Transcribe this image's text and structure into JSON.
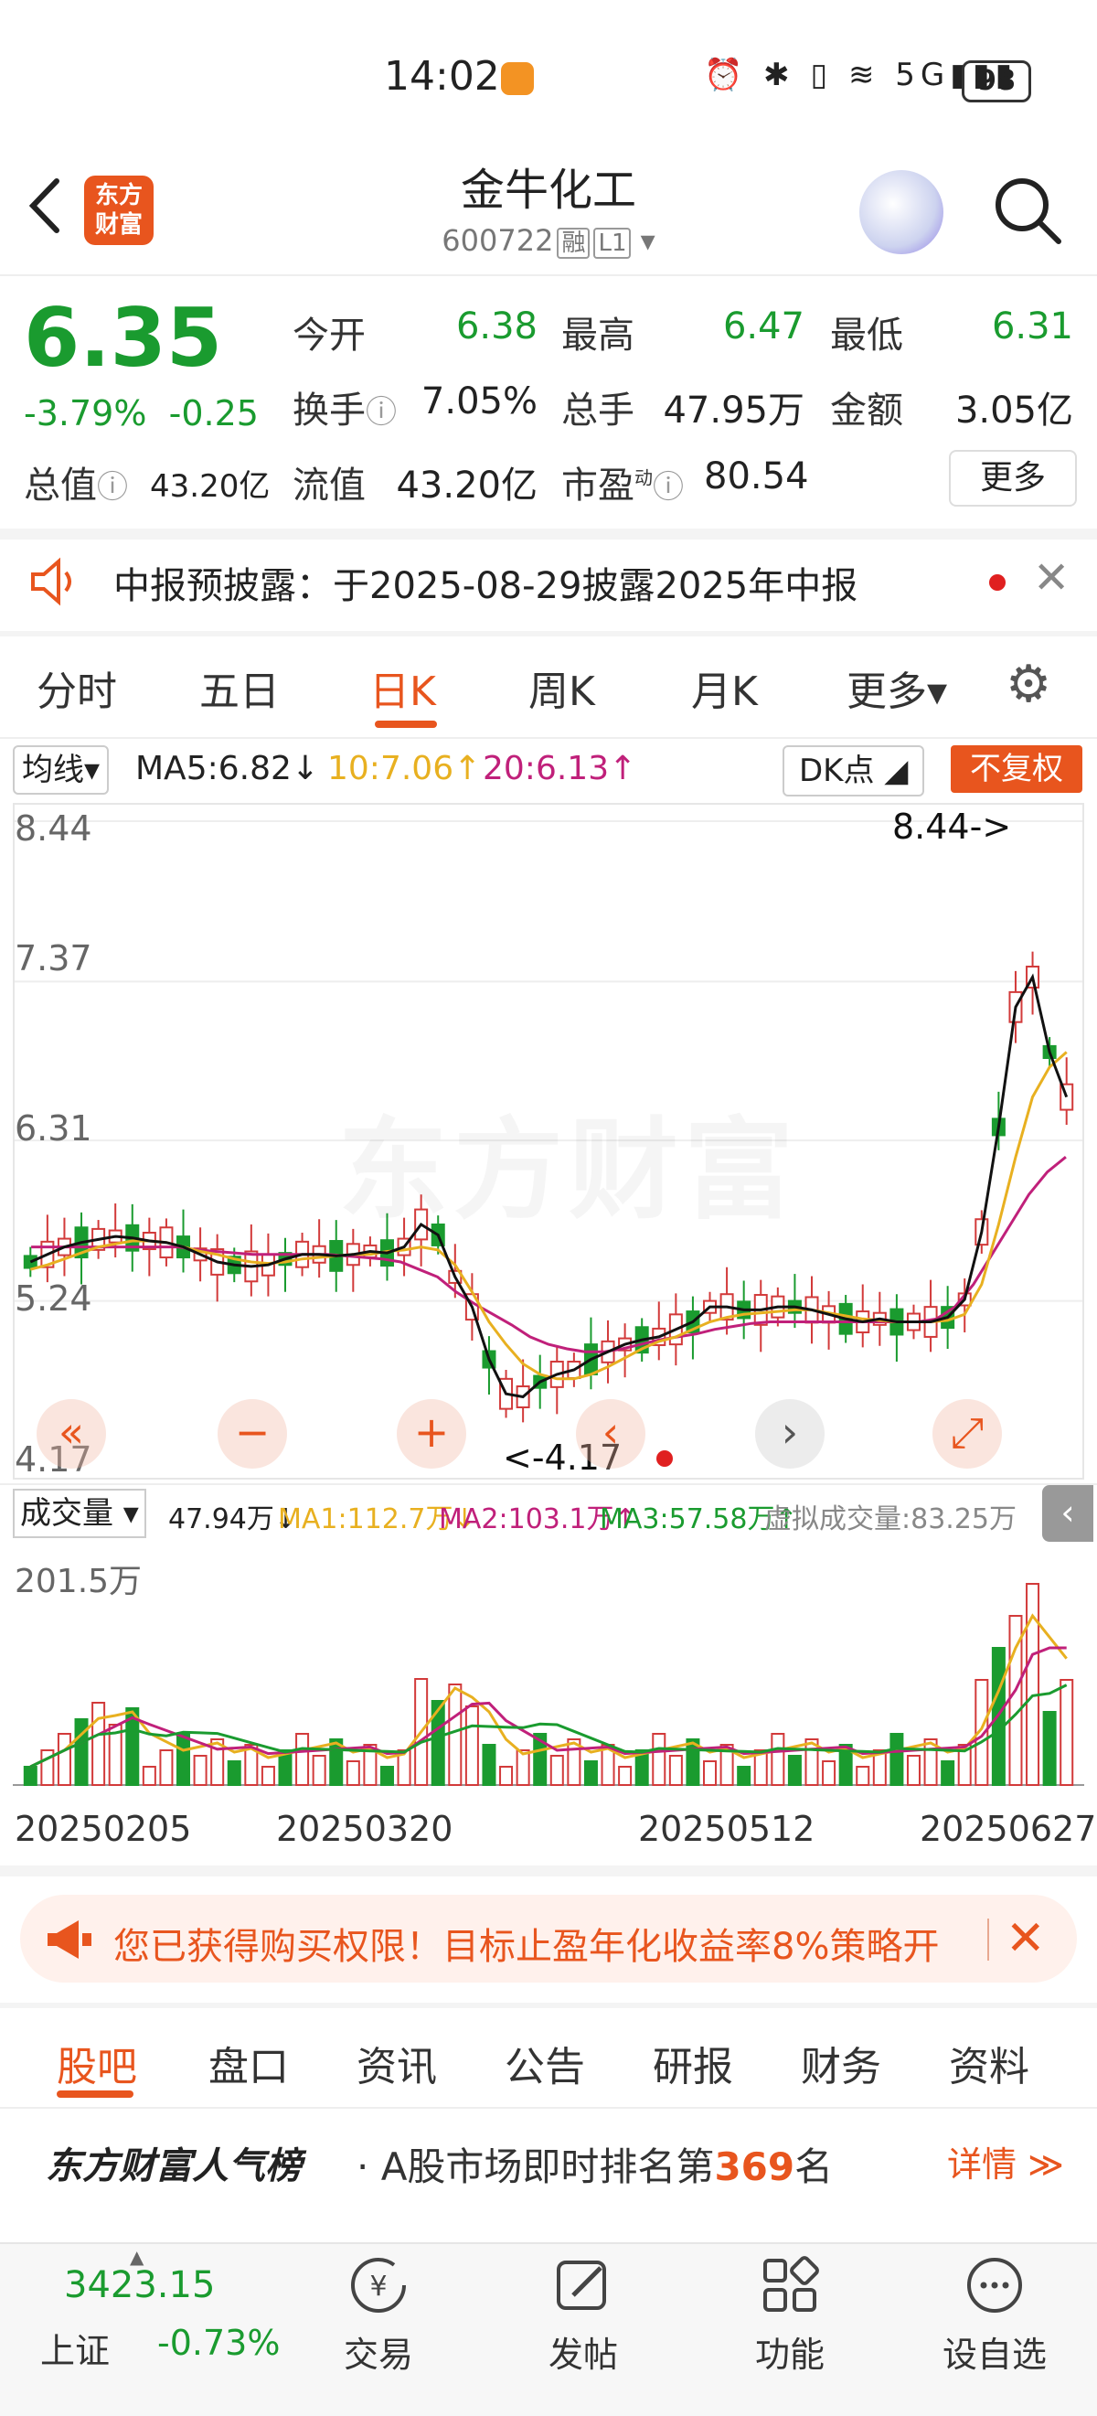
{
  "status_bar": {
    "time": "14:02",
    "battery": "98",
    "signal": "5G"
  },
  "header": {
    "logo_line1": "东方",
    "logo_line2": "财富",
    "title": "金牛化工",
    "code": "600722",
    "tag1": "融",
    "tag2": "L1"
  },
  "quote": {
    "price": "6.35",
    "change_pct": "-3.79%",
    "change": "-0.25",
    "open_label": "今开",
    "open": "6.38",
    "high_label": "最高",
    "high": "6.47",
    "low_label": "最低",
    "low": "6.31",
    "turnover_label": "换手",
    "turnover": "7.05%",
    "volume_label": "总手",
    "volume": "47.95万",
    "amount_label": "金额",
    "amount": "3.05亿",
    "mktcap_label": "总值",
    "mktcap": "43.20亿",
    "float_label": "流值",
    "float_cap": "43.20亿",
    "pe_label": "市盈",
    "pe_sup": "动",
    "pe": "80.54",
    "more_label": "更多"
  },
  "notice": {
    "text": "中报预披露：于2025-08-29披露2025年中报"
  },
  "chart_tabs": [
    {
      "label": "分时"
    },
    {
      "label": "五日"
    },
    {
      "label": "日K"
    },
    {
      "label": "周K"
    },
    {
      "label": "月K"
    },
    {
      "label": "更多▾"
    }
  ],
  "ma_bar": {
    "select": "均线",
    "ma5": "MA5:6.82↓",
    "ma10": "10:7.06↑",
    "ma20": "20:6.13↑",
    "dk": "DK点",
    "fuquan": "不复权"
  },
  "chart_data": {
    "type": "candlestick",
    "y_labels": [
      "8.44",
      "7.37",
      "6.31",
      "5.24",
      "4.17"
    ],
    "ylim": [
      4.17,
      8.44
    ],
    "max_annotation": "8.44->",
    "min_annotation": "<-4.17",
    "watermark": "东方财富",
    "colors": {
      "up": "#d23a3a",
      "down": "#1a9b2f",
      "ma5": "#111111",
      "ma10": "#e8b020",
      "ma20": "#c0207a"
    },
    "ma5": [
      5.5,
      5.55,
      5.6,
      5.63,
      5.65,
      5.67,
      5.66,
      5.64,
      5.63,
      5.6,
      5.55,
      5.5,
      5.48,
      5.47,
      5.48,
      5.52,
      5.55,
      5.55,
      5.54,
      5.55,
      5.57,
      5.56,
      5.6,
      5.75,
      5.68,
      5.4,
      5.2,
      4.85,
      4.62,
      4.6,
      4.7,
      4.75,
      4.78,
      4.85,
      4.9,
      4.95,
      4.98,
      5.0,
      5.05,
      5.1,
      5.2,
      5.2,
      5.18,
      5.18,
      5.2,
      5.2,
      5.18,
      5.15,
      5.12,
      5.1,
      5.12,
      5.1,
      5.1,
      5.1,
      5.13,
      5.25,
      5.7,
      6.4,
      7.2,
      7.4,
      6.9,
      6.6
    ],
    "ma10": [
      5.45,
      5.48,
      5.52,
      5.56,
      5.6,
      5.62,
      5.64,
      5.64,
      5.63,
      5.6,
      5.57,
      5.55,
      5.52,
      5.5,
      5.49,
      5.5,
      5.52,
      5.53,
      5.54,
      5.55,
      5.55,
      5.57,
      5.58,
      5.6,
      5.58,
      5.48,
      5.3,
      5.1,
      4.95,
      4.82,
      4.75,
      4.72,
      4.72,
      4.75,
      4.8,
      4.86,
      4.92,
      4.97,
      5.0,
      5.05,
      5.1,
      5.13,
      5.15,
      5.16,
      5.17,
      5.18,
      5.18,
      5.16,
      5.14,
      5.12,
      5.11,
      5.1,
      5.1,
      5.1,
      5.11,
      5.15,
      5.35,
      5.75,
      6.2,
      6.6,
      6.8,
      6.9
    ],
    "ma20": [
      5.6,
      5.6,
      5.6,
      5.6,
      5.6,
      5.6,
      5.6,
      5.6,
      5.6,
      5.58,
      5.57,
      5.56,
      5.55,
      5.55,
      5.55,
      5.55,
      5.55,
      5.54,
      5.53,
      5.52,
      5.5,
      5.45,
      5.4,
      5.3,
      5.22,
      5.15,
      5.08,
      5.0,
      4.95,
      4.92,
      4.9,
      4.9,
      4.92,
      4.95,
      4.98,
      5.0,
      5.02,
      5.05,
      5.07,
      5.09,
      5.1,
      5.1,
      5.1,
      5.1,
      5.1,
      5.1,
      5.1,
      5.1,
      5.1,
      5.12,
      5.2,
      5.35,
      5.55,
      5.75,
      5.95,
      6.1,
      6.2
    ]
  },
  "chart_controls": [
    "«",
    "−",
    "+",
    "‹",
    "›",
    "⤢"
  ],
  "volume_bar": {
    "select": "成交量",
    "vol": "47.94万↓",
    "ma1": "MA1:112.7万↓",
    "ma2": "MA2:103.1万↑",
    "ma3": "MA3:57.58万↑",
    "virtual": "虚拟成交量:83.25万",
    "max": "201.5万"
  },
  "dates": [
    "20250205",
    "20250320",
    "20250512",
    "20250627"
  ],
  "promo": {
    "text": "您已获得购买权限！目标止盈年化收益率8%策略开"
  },
  "bottom_tabs": [
    {
      "label": "股吧"
    },
    {
      "label": "盘口"
    },
    {
      "label": "资讯"
    },
    {
      "label": "公告"
    },
    {
      "label": "研报"
    },
    {
      "label": "财务"
    },
    {
      "label": "资料"
    }
  ],
  "rank": {
    "brand": "东方财富人气榜",
    "prefix": "· A股市场即时排名第",
    "number": "369",
    "suffix": "名",
    "detail": "详情 ≫"
  },
  "index": {
    "value": "3423.15",
    "name": "上证",
    "change": "-0.73%"
  },
  "nav": [
    {
      "label": "交易",
      "icon": "yen-icon"
    },
    {
      "label": "发帖",
      "icon": "edit-icon"
    },
    {
      "label": "功能",
      "icon": "grid-icon"
    },
    {
      "label": "设自选",
      "icon": "more-icon"
    }
  ]
}
